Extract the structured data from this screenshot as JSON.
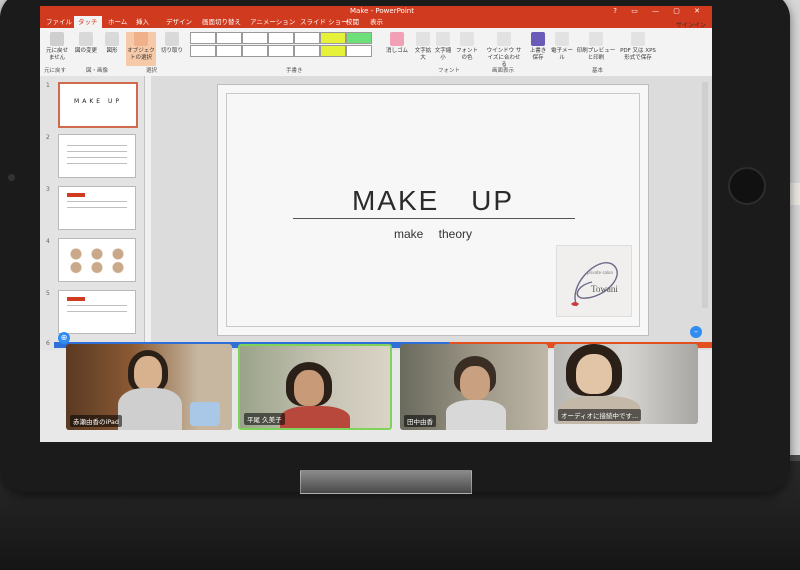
{
  "window": {
    "title": "Make - PowerPoint",
    "controls": "? ▭ — ▢ ✕",
    "sign_in": "サインイン"
  },
  "tabs": [
    "ファイル",
    "タッチ",
    "ホーム",
    "挿入",
    "デザイン",
    "画面切り替え",
    "アニメーション",
    "スライド ショー",
    "校閲",
    "表示"
  ],
  "ribbon": {
    "buttons": {
      "undo": "元に戻せません",
      "format_painter": "図の変更",
      "shapes": "図形",
      "select_object": "オブジェクトの選択",
      "cut": "切り取り",
      "eraser": "消しゴム",
      "font_bigger": "文字拡大",
      "font_smaller": "文字縮小",
      "font_color": "フォントの色",
      "fit_window": "ウインドウ サイズに合わせる",
      "save": "上書き保存",
      "email": "電子メール",
      "print_preview": "印刷プレビューと印刷",
      "pdf": "PDF 又は XPS 形式で保存"
    },
    "groups": [
      "元に戻す",
      "図・画像",
      "選択",
      "手書き",
      "フォント",
      "画面表示",
      "基本"
    ]
  },
  "thumbnails": [
    {
      "num": "1",
      "text": "MAKE UP"
    },
    {
      "num": "2",
      "text": ""
    },
    {
      "num": "3",
      "text": ""
    },
    {
      "num": "4",
      "text": ""
    },
    {
      "num": "5",
      "text": ""
    },
    {
      "num": "6",
      "text": ""
    }
  ],
  "slide": {
    "title": "MAKE UP",
    "subtitle": "make theory",
    "logo_text": "Towani",
    "logo_small": "private salon"
  },
  "zoom_participants": [
    {
      "name": "赤瀬由香のiPad"
    },
    {
      "name": "平尾 久美子"
    },
    {
      "name": "田中由香"
    },
    {
      "name": "オーディオに接続中です..."
    }
  ],
  "colors": {
    "office_accent": "#d03a1e",
    "zoom_blue": "#2f6fd8",
    "active_speaker": "#7fd35a"
  }
}
